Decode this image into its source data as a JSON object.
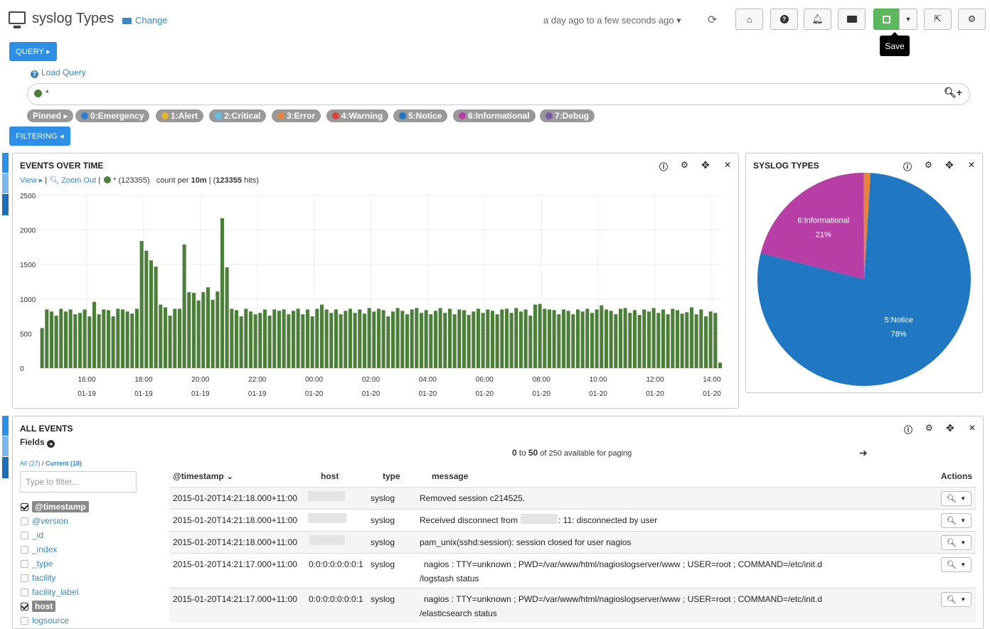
{
  "header": {
    "title": "syslog Types",
    "change_label": "Change",
    "timerange": "a day ago to a few seconds ago ▾",
    "save_tooltip": "Save"
  },
  "query": {
    "button_label": "QUERY ▸",
    "load_query_label": "Load Query",
    "text": "*",
    "dot_color": "#4b7f3a"
  },
  "pills": [
    {
      "label": "Pinned ▸",
      "color": ""
    },
    {
      "label": "0:Emergency",
      "color": "#2d7fd5"
    },
    {
      "label": "1:Alert",
      "color": "#e5b62b"
    },
    {
      "label": "2:Critical",
      "color": "#5fc4e8"
    },
    {
      "label": "3:Error",
      "color": "#e8833a"
    },
    {
      "label": "4:Warning",
      "color": "#d9453c"
    },
    {
      "label": "5:Notice",
      "color": "#1f78c1"
    },
    {
      "label": "6:Informational",
      "color": "#b63ea5"
    },
    {
      "label": "7:Debug",
      "color": "#7a5aa8"
    }
  ],
  "filtering": {
    "button_label": "FILTERING ◂"
  },
  "events_panel": {
    "title": "EVENTS OVER TIME",
    "view_label": "View ▸",
    "zoom_out_label": "Zoom Out",
    "series_label": "* (123355)",
    "count_prefix": "count per",
    "interval": "10m",
    "hits_label": "123355",
    "hits_suffix": "hits)"
  },
  "chart_data": [
    {
      "type": "bar",
      "series_color": "#4b7f3a",
      "ylim": [
        0,
        2500
      ],
      "yticks": [
        "0",
        "500",
        "1000",
        "1500",
        "2000",
        "2500"
      ],
      "xticks": [
        {
          "time": "16:00",
          "date": "01-19"
        },
        {
          "time": "18:00",
          "date": "01-19"
        },
        {
          "time": "20:00",
          "date": "01-19"
        },
        {
          "time": "22:00",
          "date": "01-19"
        },
        {
          "time": "00:00",
          "date": "01-20"
        },
        {
          "time": "02:00",
          "date": "01-20"
        },
        {
          "time": "04:00",
          "date": "01-20"
        },
        {
          "time": "06:00",
          "date": "01-20"
        },
        {
          "time": "08:00",
          "date": "01-20"
        },
        {
          "time": "10:00",
          "date": "01-20"
        },
        {
          "time": "12:00",
          "date": "01-20"
        },
        {
          "time": "14:00",
          "date": "01-20"
        }
      ],
      "values": [
        580,
        850,
        820,
        760,
        860,
        820,
        850,
        780,
        800,
        850,
        750,
        960,
        780,
        850,
        840,
        750,
        860,
        850,
        820,
        790,
        860,
        1840,
        1700,
        1560,
        1470,
        920,
        880,
        760,
        860,
        860,
        1790,
        1100,
        1090,
        980,
        1100,
        1170,
        990,
        1110,
        2170,
        1460,
        860,
        840,
        750,
        860,
        820,
        780,
        800,
        850,
        760,
        850,
        830,
        850,
        780,
        830,
        860,
        780,
        850,
        750,
        860,
        920,
        850,
        800,
        850,
        780,
        830,
        860,
        800,
        850,
        790,
        870,
        820,
        860,
        840,
        750,
        820,
        870,
        830,
        780,
        850,
        870,
        800,
        840,
        780,
        830,
        870,
        800,
        860,
        780,
        850,
        840,
        770,
        820,
        860,
        800,
        850,
        830,
        780,
        850,
        860,
        800,
        870,
        820,
        850,
        760,
        920,
        930,
        860,
        850,
        840,
        780,
        850,
        830,
        780,
        850,
        820,
        860,
        800,
        850,
        910,
        850,
        830,
        780,
        860,
        870,
        800,
        840,
        770,
        850,
        820,
        870,
        800,
        850,
        780,
        860,
        840,
        790,
        810,
        880,
        780,
        850,
        750,
        820,
        800,
        80
      ]
    },
    {
      "type": "pie",
      "slices": [
        {
          "label": "5:Notice",
          "value": 78,
          "color": "#1f78c1"
        },
        {
          "label": "6:Informational",
          "value": 21,
          "color": "#b63ea5"
        },
        {
          "label": "3:Error",
          "value": 1,
          "color": "#e8833a"
        }
      ],
      "value_labels": {
        "5:Notice": "78%",
        "6:Informational": "21%"
      }
    }
  ],
  "pie_panel": {
    "title": "SYSLOG TYPES"
  },
  "all_events": {
    "title": "ALL EVENTS",
    "fields_title": "Fields",
    "tab_all": "All (27)",
    "tab_sep": " / ",
    "tab_current": "Current (18)",
    "filter_placeholder": "Type to filter...",
    "fields": [
      {
        "name": "@timestamp",
        "checked": true
      },
      {
        "name": "@version",
        "checked": false
      },
      {
        "name": "_id",
        "checked": false
      },
      {
        "name": "_index",
        "checked": false
      },
      {
        "name": "_type",
        "checked": false
      },
      {
        "name": "facility",
        "checked": false
      },
      {
        "name": "facility_label",
        "checked": false
      },
      {
        "name": "host",
        "checked": true
      },
      {
        "name": "logsource",
        "checked": false
      }
    ],
    "paging_from": "0",
    "paging_to_word": "to",
    "paging_to": "50",
    "paging_rest": "of 250 available for paging",
    "columns": {
      "timestamp": "@timestamp",
      "host": "host",
      "type": "type",
      "message": "message",
      "actions": "Actions"
    },
    "rows": [
      {
        "timestamp": "2015-01-20T14:21:18.000+11:00",
        "host": "",
        "type": "syslog",
        "message": "Removed session c214525.",
        "message2": ""
      },
      {
        "timestamp": "2015-01-20T14:21:18.000+11:00",
        "host": "",
        "type": "syslog",
        "message": "Received disconnect from",
        "message_tail": ": 11: disconnected by user",
        "message2": ""
      },
      {
        "timestamp": "2015-01-20T14:21:18.000+11:00",
        "host": "",
        "type": "syslog",
        "message": "pam_unix(sshd:session): session closed for user nagios",
        "message2": ""
      },
      {
        "timestamp": "2015-01-20T14:21:17.000+11:00",
        "host": "0:0:0:0:0:0:0:1",
        "type": "syslog",
        "message": "nagios : TTY=unknown ; PWD=/var/www/html/nagioslogserver/www ; USER=root ; COMMAND=/etc/init.d",
        "message2": "/logstash status"
      },
      {
        "timestamp": "2015-01-20T14:21:17.000+11:00",
        "host": "0:0:0:0:0:0:0:1",
        "type": "syslog",
        "message": "nagios : TTY=unknown ; PWD=/var/www/html/nagioslogserver/www ; USER=root ; COMMAND=/etc/init.d",
        "message2": "/elasticsearch status"
      }
    ]
  }
}
